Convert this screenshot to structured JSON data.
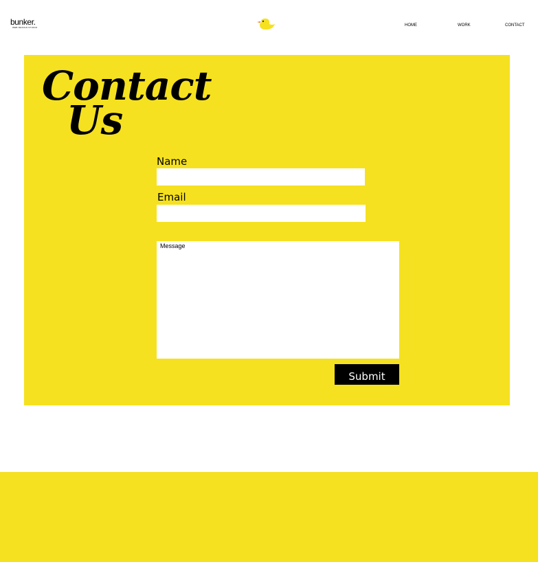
{
  "brand": {
    "logo_text": "bunker.",
    "logo_tagline": "WEB DESIGN STUDIO",
    "mascot_icon": "duck-icon",
    "accent_color": "#f5e11f"
  },
  "nav": {
    "home": "HOME",
    "work": "WORK",
    "contact": "CONTACT"
  },
  "contact": {
    "title_line1": "Contact",
    "title_line2": "Us",
    "name_label": "Name",
    "name_value": "",
    "email_label": "Email",
    "email_value": "",
    "message_placeholder": "Message",
    "submit_label": "Submit"
  }
}
